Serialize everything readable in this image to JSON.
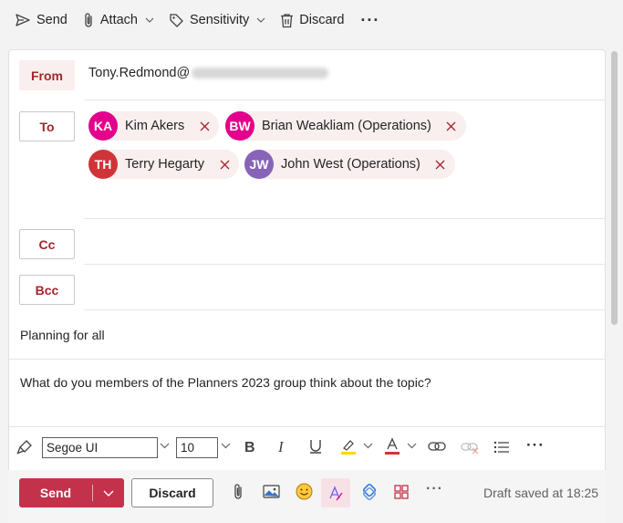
{
  "toolbar": {
    "send_label": "Send",
    "attach_label": "Attach",
    "sensitivity_label": "Sensitivity",
    "discard_label": "Discard",
    "more_label": "···"
  },
  "from": {
    "label": "From",
    "address_prefix": "Tony.Redmond@",
    "address_domain_redacted": "redacted"
  },
  "to": {
    "label": "To",
    "recipients": [
      {
        "initials": "KA",
        "name": "Kim Akers",
        "color": "#e3008c"
      },
      {
        "initials": "BW",
        "name": "Brian Weakliam (Operations)",
        "color": "#e3008c"
      },
      {
        "initials": "TH",
        "name": "Terry Hegarty",
        "color": "#d13438"
      },
      {
        "initials": "JW",
        "name": "John West (Operations)",
        "color": "#8764b8"
      }
    ]
  },
  "cc": {
    "label": "Cc"
  },
  "bcc": {
    "label": "Bcc"
  },
  "subject": "Planning for all",
  "body": "What do you members of the Planners 2023 group think about the topic?",
  "format": {
    "font_name": "Segoe UI",
    "font_size": "10",
    "more_label": "···"
  },
  "actions": {
    "send_label": "Send",
    "discard_label": "Discard",
    "more_label": "···",
    "draft_status": "Draft saved at 18:25"
  },
  "colors": {
    "accent": "#c4314b",
    "field_label": "#a4262c",
    "chip_bg": "#f8efee"
  }
}
